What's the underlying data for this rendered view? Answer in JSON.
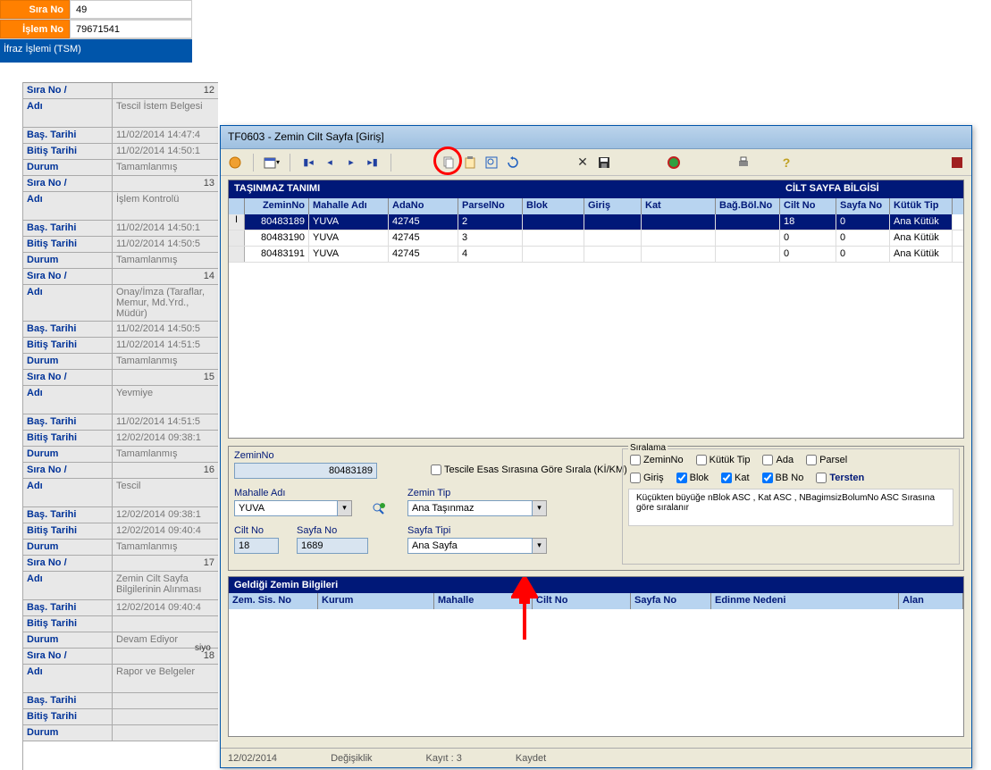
{
  "header": {
    "sira_no_label": "Sıra No",
    "sira_no_value": "49",
    "islem_no_label": "İşlem No",
    "islem_no_value": "79671541",
    "blue_bar": "İfraz İşlemi (TSM)"
  },
  "left_items": [
    {
      "sira": "12",
      "adi": "Tescil İstem Belgesi",
      "bas": "11/02/2014 14:47:4",
      "bit": "11/02/2014 14:50:1",
      "durum": "Tamamlanmış"
    },
    {
      "sira": "13",
      "adi": "İşlem Kontrolü",
      "bas": "11/02/2014 14:50:1",
      "bit": "11/02/2014 14:50:5",
      "durum": "Tamamlanmış"
    },
    {
      "sira": "14",
      "adi": "Onay/İmza (Taraflar, Memur, Md.Yrd., Müdür)",
      "bas": "11/02/2014 14:50:5",
      "bit": "11/02/2014 14:51:5",
      "durum": "Tamamlanmış"
    },
    {
      "sira": "15",
      "adi": "Yevmiye",
      "bas": "11/02/2014 14:51:5",
      "bit": "12/02/2014 09:38:1",
      "durum": "Tamamlanmış"
    },
    {
      "sira": "16",
      "adi": "Tescil",
      "bas": "12/02/2014 09:38:1",
      "bit": "12/02/2014 09:40:4",
      "durum": "Tamamlanmış"
    },
    {
      "sira": "17",
      "adi": "Zemin Cilt Sayfa Bilgilerinin Alınması",
      "bas": "12/02/2014 09:40:4",
      "bit": "",
      "durum": "Devam Ediyor"
    },
    {
      "sira": "18",
      "adi": "Rapor ve Belgeler",
      "bas": "",
      "bit": "",
      "durum": ""
    }
  ],
  "labels": {
    "sira": "Sıra No",
    "adi": "Adı",
    "bas": "Baş. Tarihi",
    "bit": "Bitiş Tarihi",
    "durum": "Durum",
    "slash": "/"
  },
  "dialog": {
    "title": "TF0603 - Zemin Cilt Sayfa [Giriş]",
    "grid": {
      "section1": "TAŞINMAZ TANIMI",
      "section2": "CİLT SAYFA BİLGİSİ",
      "cols": [
        "ZeminNo",
        "Mahalle Adı",
        "AdaNo",
        "ParselNo",
        "Blok",
        "Giriş",
        "Kat",
        "Bağ.Böl.No",
        "Cilt No",
        "Sayfa No",
        "Kütük Tip"
      ],
      "rows": [
        {
          "mark": "I",
          "zemin": "80483189",
          "mahalle": "YUVA",
          "ada": "42745",
          "parsel": "2",
          "blok": "",
          "giris": "",
          "kat": "",
          "bagbol": "",
          "cilt": "18",
          "sayfa": "0",
          "kutuk": "Ana Kütük",
          "selected": true
        },
        {
          "mark": "",
          "zemin": "80483190",
          "mahalle": "YUVA",
          "ada": "42745",
          "parsel": "3",
          "blok": "",
          "giris": "",
          "kat": "",
          "bagbol": "",
          "cilt": "0",
          "sayfa": "0",
          "kutuk": "Ana Kütük"
        },
        {
          "mark": "",
          "zemin": "80483191",
          "mahalle": "YUVA",
          "ada": "42745",
          "parsel": "4",
          "blok": "",
          "giris": "",
          "kat": "",
          "bagbol": "",
          "cilt": "0",
          "sayfa": "0",
          "kutuk": "Ana Kütük"
        }
      ]
    },
    "mid": {
      "zemin_label": "ZeminNo",
      "zemin_value": "80483189",
      "mahalle_label": "Mahalle Adı",
      "mahalle_value": "YUVA",
      "zemintip_label": "Zemin Tip",
      "zemintip_value": "Ana Taşınmaz",
      "cilt_label": "Cilt No",
      "cilt_value": "18",
      "sayfano_label": "Sayfa No",
      "sayfano_value": "1689",
      "sayfatipi_label": "Sayfa Tipi",
      "sayfatipi_value": "Ana Sayfa",
      "tescile_label": "Tescile Esas Sırasına Göre Sırala (Kİ/KM)"
    },
    "siralama": {
      "title": "Sıralama",
      "zemin": "ZeminNo",
      "kutuk": "Kütük Tip",
      "ada": "Ada",
      "parsel": "Parsel",
      "giris": "Giriş",
      "blok": "Blok",
      "kat": "Kat",
      "bbno": "BB No",
      "tersten": "Tersten",
      "note": "Küçükten büyüğe nBlok ASC , Kat ASC , NBagimsizBolumNo ASC Sırasına göre sıralanır"
    },
    "bottom": {
      "title": "Geldiği Zemin Bilgileri",
      "cols": [
        "Zem. Sis. No",
        "Kurum",
        "Mahalle",
        "Cilt No",
        "Sayfa No",
        "Edinme Nedeni",
        "Alan"
      ]
    },
    "status": {
      "date": "12/02/2014",
      "degisiklik": "Değişiklik",
      "kayit": "Kayıt : 3",
      "kaydet": "Kaydet"
    }
  },
  "bg_hint": "siyo"
}
